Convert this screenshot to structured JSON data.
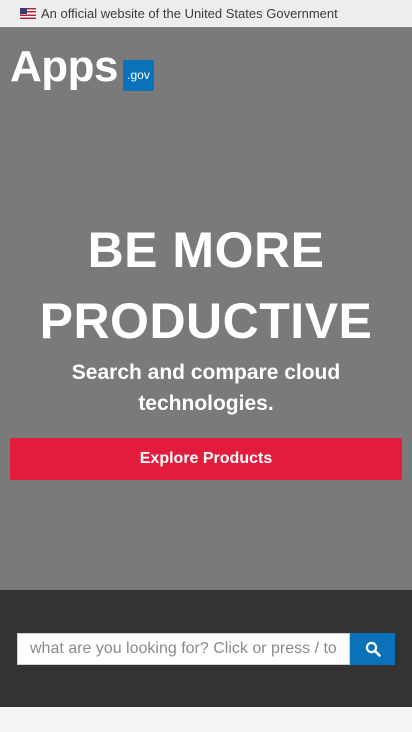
{
  "gov_banner": {
    "text": "An official website of the United States Government",
    "flag_icon": "us-flag-icon"
  },
  "logo": {
    "name": "Apps",
    "badge": ".gov"
  },
  "hero": {
    "headline_line1": "BE MORE",
    "headline_line2": "PRODUCTIVE",
    "subheading": "Search and compare cloud technologies.",
    "cta_label": "Explore Products"
  },
  "search": {
    "placeholder": "what are you looking for? Click or press / to",
    "button_icon": "search-icon"
  },
  "colors": {
    "hero_bg": "#7a7a7a",
    "cta": "#e31c3d",
    "accent_blue": "#0a72b8",
    "search_band": "#333333"
  }
}
